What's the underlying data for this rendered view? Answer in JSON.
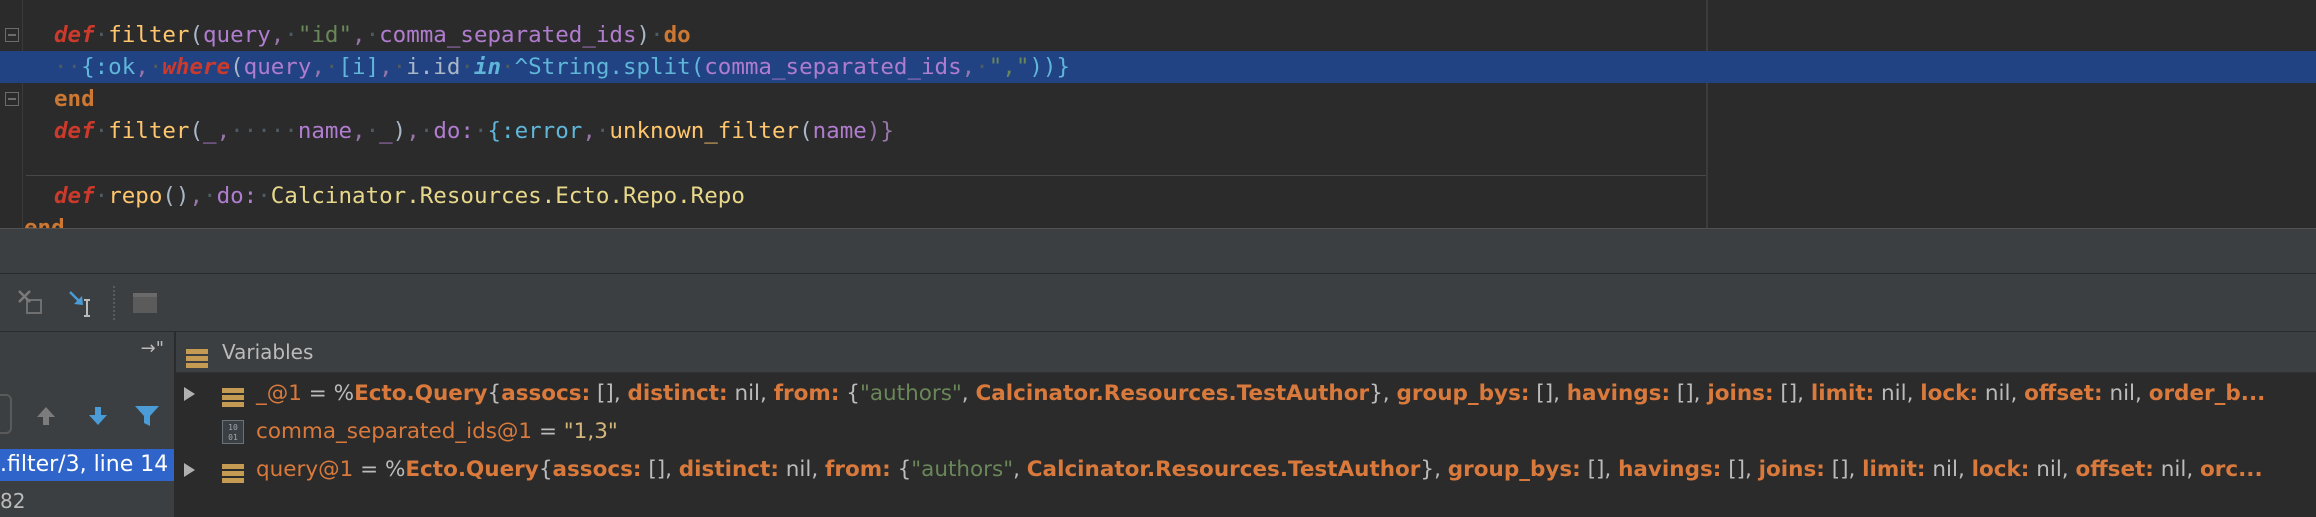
{
  "editor": {
    "lines": {
      "l1": {
        "kw": "def",
        "fn": "filter",
        "args": "query",
        "s1": "\"id\"",
        "a2": "comma_separated_ids",
        "do": "do"
      },
      "l2": {
        "ok": "{:ok",
        "where": "where",
        "query": "query",
        "list": "[i]",
        "iid": "i.id",
        "in": "in",
        "caret": "^",
        "mod": "String",
        "split": ".split(",
        "arg": "comma_separated_ids",
        "sep": "\",\"",
        "close": "))}"
      },
      "l3": {
        "end": "end"
      },
      "l4": {
        "kw": "def",
        "fn": "filter",
        "u1": "_",
        "name": "name",
        "u2": "_",
        "do": "do:",
        "err": "{:error",
        "call": "unknown_filter",
        "arg": "name",
        "close": ")}"
      },
      "l5": {
        "kw": "def",
        "fn": "repo",
        "parens": "()",
        "do": "do:",
        "mod": "Calcinator.Resources.Ecto.Repo.Repo"
      },
      "l6": {
        "end": "end"
      }
    }
  },
  "toolbar": {
    "icons": [
      "clear-breakpoints-icon",
      "step-into-cursor-icon",
      "stop-icon"
    ]
  },
  "frames": {
    "pin_label": "→\"",
    "selected_frame": ".filter/3, line 14",
    "next_frame": "82"
  },
  "variables": {
    "title": "Variables",
    "rows": [
      {
        "name": "_@1",
        "eq": " = ",
        "pct": "%",
        "module": "Ecto.Query",
        "body_prefix": "{",
        "k1": "assocs:",
        "v1": " [], ",
        "k2": "distinct:",
        "v2": " nil, ",
        "k3": "from:",
        "v3a": " {",
        "v3s": "\"authors\"",
        "v3b": ", ",
        "v3m": "Calcinator.Resources.TestAuthor",
        "v3c": "}, ",
        "k4": "group_bys:",
        "v4": " [], ",
        "k5": "havings:",
        "v5": " [], ",
        "k6": "joins:",
        "v6": " [], ",
        "k7": "limit:",
        "v7": " nil, ",
        "k8": "lock:",
        "v8": " nil, ",
        "k9": "offset:",
        "v9": " nil, ",
        "k10": "order_b..."
      },
      {
        "name": "comma_separated_ids@1",
        "eq": " = ",
        "value": "\"1,3\""
      },
      {
        "name": "query@1",
        "eq": " = ",
        "pct": "%",
        "module": "Ecto.Query",
        "body_prefix": "{",
        "k1": "assocs:",
        "v1": " [], ",
        "k2": "distinct:",
        "v2": " nil, ",
        "k3": "from:",
        "v3a": " {",
        "v3s": "\"authors\"",
        "v3b": ", ",
        "v3m": "Calcinator.Resources.TestAuthor",
        "v3c": "}, ",
        "k4": "group_bys:",
        "v4": " [], ",
        "k5": "havings:",
        "v5": " [], ",
        "k6": "joins:",
        "v6": " [], ",
        "k7": "limit:",
        "v7": " nil, ",
        "k8": "lock:",
        "v8": " nil, ",
        "k9": "offset:",
        "v9": " nil, ",
        "k10": "orc..."
      }
    ]
  },
  "colors": {
    "selection": "#214283",
    "frame_selected": "#2f65ca",
    "panel_bg": "#3c3f41",
    "editor_bg": "#2b2b2b"
  }
}
